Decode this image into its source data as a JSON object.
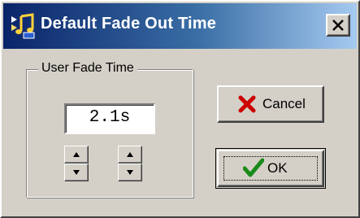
{
  "window": {
    "title": "Default Fade Out Time",
    "app_icon": "music-note-icon",
    "close_icon": "close-icon",
    "titlebar_colors": {
      "start": "#0a246a",
      "end": "#a6caf0"
    },
    "face_color": "#d4d0c8"
  },
  "group": {
    "label": "User Fade Time"
  },
  "time_field": {
    "value": "2.1s"
  },
  "spinners": [
    {
      "up_icon": "arrow-up-icon",
      "down_icon": "arrow-down-icon"
    },
    {
      "up_icon": "arrow-up-icon",
      "down_icon": "arrow-down-icon"
    }
  ],
  "buttons": {
    "cancel": {
      "label": "Cancel",
      "icon": "red-x-icon",
      "color": "#cc0000"
    },
    "ok": {
      "label": "OK",
      "icon": "green-check-icon",
      "color": "#1a8a1a"
    }
  }
}
